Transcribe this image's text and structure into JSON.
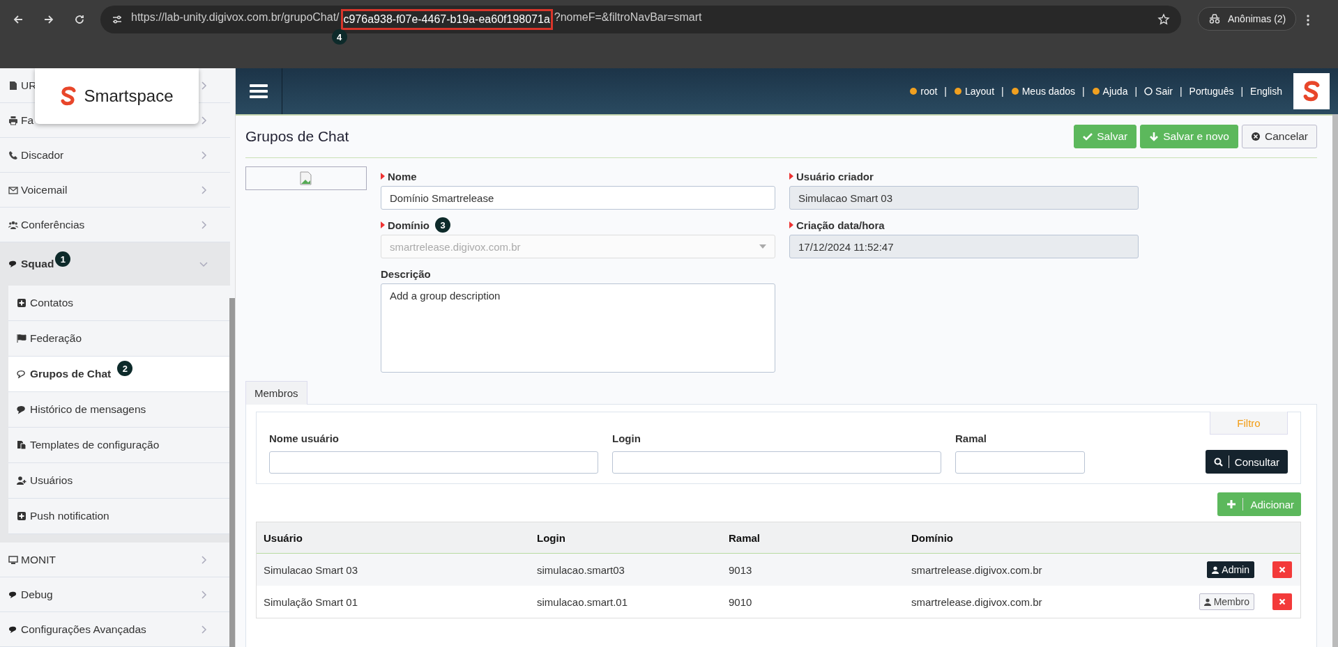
{
  "browser": {
    "url_parts": [
      {
        "text": "https://lab-unity.digivox.com.br/grupoChat/",
        "highlighted": false
      },
      {
        "text": "c976a938-f07e-4467-b19a-ea60f198071a",
        "highlighted": true,
        "marker": "4"
      },
      {
        "text": "?nomeF=&filtroNavBar=smart",
        "highlighted": false
      }
    ],
    "profile": "Anônimas (2)"
  },
  "logo": {
    "name": "Smartspace"
  },
  "sidebar": {
    "items": [
      {
        "label": "UR",
        "expanded": false
      },
      {
        "label": "Fa",
        "expanded": false
      },
      {
        "label": "Discador",
        "expanded": false
      },
      {
        "label": "Voicemail",
        "expanded": false
      },
      {
        "label": "Conferências",
        "expanded": false
      },
      {
        "label": "Squad",
        "expanded": true,
        "marker": "1",
        "children": [
          {
            "label": "Contatos",
            "selected": false
          },
          {
            "label": "Federação",
            "selected": false
          },
          {
            "label": "Grupos de Chat",
            "selected": true,
            "marker": "2"
          },
          {
            "label": "Histórico de mensagens",
            "selected": false
          },
          {
            "label": "Templates de configuração",
            "selected": false
          },
          {
            "label": "Usuários",
            "selected": false
          },
          {
            "label": "Push notification",
            "selected": false
          }
        ]
      },
      {
        "label": "MONIT",
        "expanded": false
      },
      {
        "label": "Debug",
        "expanded": false
      },
      {
        "label": "Configurações Avançadas",
        "expanded": false
      }
    ]
  },
  "header": {
    "separator": "|",
    "links": [
      "root",
      "Layout",
      "Meus dados",
      "Ajuda",
      "Sair"
    ],
    "languages": [
      "Português",
      "English"
    ]
  },
  "form": {
    "title": "Grupos de Chat",
    "actions": [
      {
        "label": "Salvar",
        "kind": "primary"
      },
      {
        "label": "Salvar e novo",
        "kind": "primary"
      },
      {
        "label": "Cancelar",
        "kind": "secondary"
      }
    ],
    "left_fields": [
      {
        "label": "Nome",
        "required": true,
        "kind": "input",
        "value": "Domínio Smartrelease"
      },
      {
        "label": "Domínio",
        "required": true,
        "kind": "select",
        "value": "smartrelease.digivox.com.br",
        "disabled": true,
        "marker": "3"
      },
      {
        "label": "Descrição",
        "required": false,
        "kind": "textarea",
        "value": "Add a group description"
      }
    ],
    "right_fields": [
      {
        "label": "Usuário criador",
        "required": true,
        "kind": "readonly",
        "value": "Simulacao Smart 03"
      },
      {
        "label": "Criação data/hora",
        "required": true,
        "kind": "readonly",
        "value": "17/12/2024 11:52:47"
      }
    ]
  },
  "members": {
    "tab": "Membros",
    "filter_tab": "Filtro",
    "filters": [
      {
        "label": "Nome usuário"
      },
      {
        "label": "Login"
      },
      {
        "label": "Ramal"
      }
    ],
    "search_button": "Consultar",
    "add_button": "Adicionar",
    "columns": [
      "Usuário",
      "Login",
      "Ramal",
      "Domínio"
    ],
    "rows": [
      {
        "cells": [
          "Simulacao Smart 03",
          "simulacao.smart03",
          "9013",
          "smartrelease.digivox.com.br"
        ],
        "role": {
          "label": "Admin",
          "selected": true
        }
      },
      {
        "cells": [
          "Simulação Smart 01",
          "simulacao.smart.01",
          "9010",
          "smartrelease.digivox.com.br"
        ],
        "role": {
          "label": "Membro",
          "selected": false
        }
      }
    ]
  }
}
